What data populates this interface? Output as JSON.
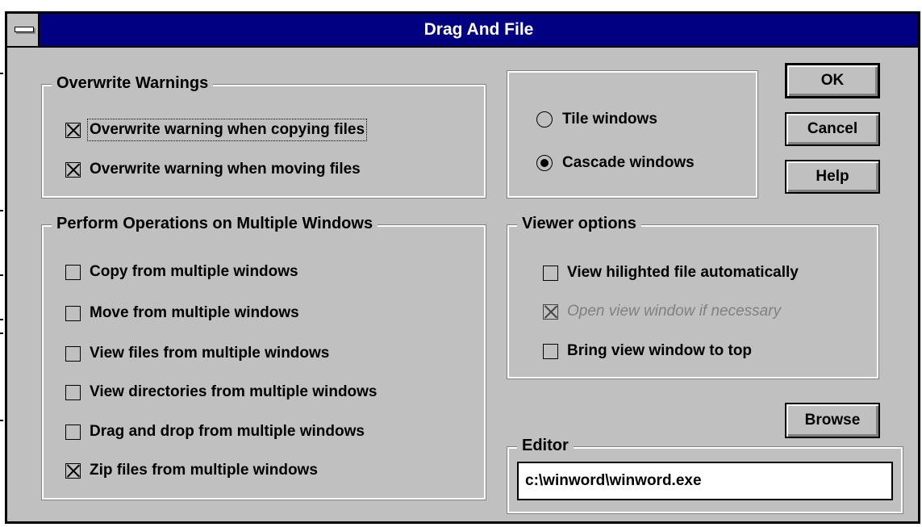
{
  "window": {
    "title": "Drag And File"
  },
  "overwrite_group": {
    "legend": "Overwrite Warnings",
    "items": [
      {
        "label": "Overwrite warning when copying files",
        "checked": true
      },
      {
        "label": "Overwrite warning when moving files",
        "checked": true
      }
    ]
  },
  "window_layout": {
    "items": [
      {
        "label": "Tile windows",
        "selected": false
      },
      {
        "label": "Cascade windows",
        "selected": true
      }
    ]
  },
  "buttons": {
    "ok": "OK",
    "cancel": "Cancel",
    "help": "Help",
    "browse": "Browse"
  },
  "multi_windows_group": {
    "legend": "Perform Operations on Multiple Windows",
    "items": [
      {
        "label": "Copy from multiple windows",
        "checked": false
      },
      {
        "label": "Move from multiple windows",
        "checked": false
      },
      {
        "label": "View files from multiple windows",
        "checked": false
      },
      {
        "label": "View directories from multiple windows",
        "checked": false
      },
      {
        "label": "Drag and drop from multiple windows",
        "checked": false
      },
      {
        "label": "Zip files from multiple windows",
        "checked": true
      }
    ]
  },
  "viewer_group": {
    "legend": "Viewer options",
    "items": [
      {
        "label": "View hilighted file automatically",
        "checked": false,
        "enabled": true
      },
      {
        "label": "Open view window if necessary",
        "checked": true,
        "enabled": false
      },
      {
        "label": "Bring view window to top",
        "checked": false,
        "enabled": true
      }
    ]
  },
  "editor_group": {
    "legend": "Editor",
    "value": "c:\\winword\\winword.exe"
  },
  "colors": {
    "titlebar": "#000080",
    "face": "#c0c0c0"
  }
}
